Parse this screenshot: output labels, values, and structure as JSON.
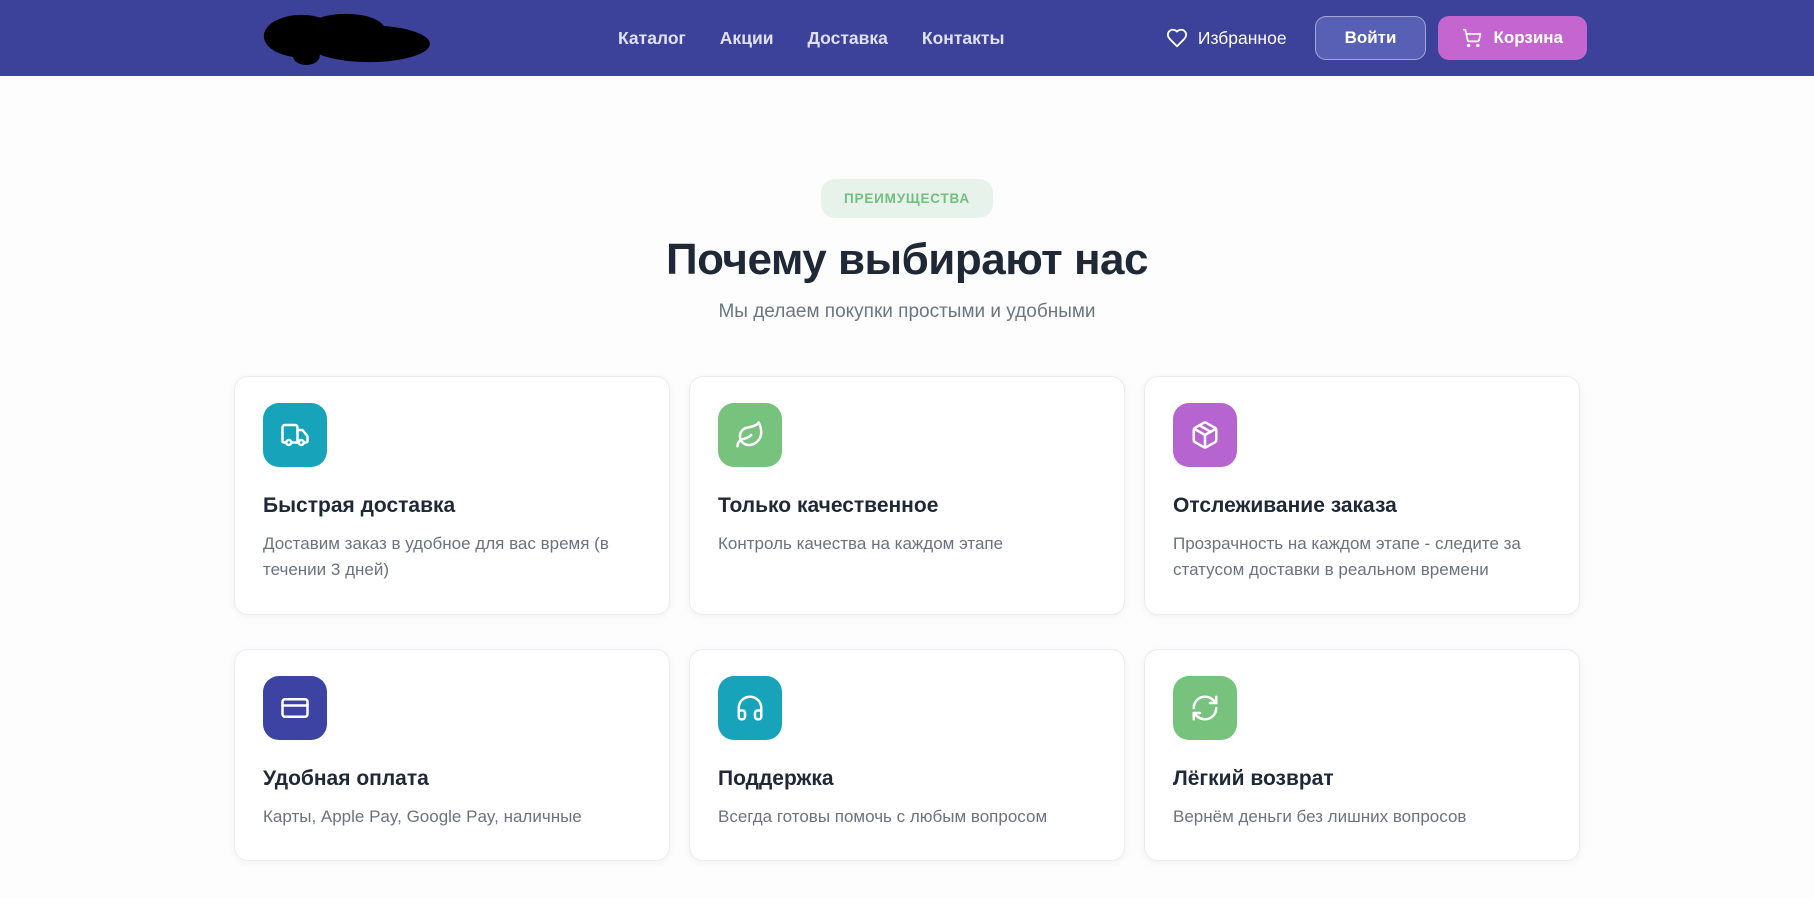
{
  "header": {
    "nav": [
      {
        "label": "Каталог"
      },
      {
        "label": "Акции"
      },
      {
        "label": "Доставка"
      },
      {
        "label": "Контакты"
      }
    ],
    "favorites_label": "Избранное",
    "login_label": "Войти",
    "cart_label": "Корзина",
    "colors": {
      "background": "#3c4199",
      "login_button": "#5760b5",
      "cart_button": "#c566d0"
    }
  },
  "advantages": {
    "badge": "ПРЕИМУЩЕСТВА",
    "title": "Почему выбирают нас",
    "subtitle": "Мы делаем покупки простыми и удобными",
    "badge_colors": {
      "background": "#e7f3ea",
      "text": "#71bf7f"
    },
    "cards": [
      {
        "icon": "truck-icon",
        "color": "#17a3ba",
        "title": "Быстрая доставка",
        "description": "Доставим заказ в удобное для вас время (в течении 3 дней)"
      },
      {
        "icon": "leaf-icon",
        "color": "#77c27d",
        "title": "Только качественное",
        "description": "Контроль качества на каждом этапе"
      },
      {
        "icon": "package-icon",
        "color": "#b665d0",
        "title": "Отслеживание заказа",
        "description": "Прозрачность на каждом этапе - следите за статусом доставки в реальном времени"
      },
      {
        "icon": "credit-card-icon",
        "color": "#3c43a2",
        "title": "Удобная оплата",
        "description": "Карты, Apple Pay, Google Pay, наличные"
      },
      {
        "icon": "headphones-icon",
        "color": "#17a3ba",
        "title": "Поддержка",
        "description": "Всегда готовы помочь с любым вопросом"
      },
      {
        "icon": "refresh-icon",
        "color": "#77c27d",
        "title": "Лёгкий возврат",
        "description": "Вернём деньги без лишних вопросов"
      }
    ]
  }
}
